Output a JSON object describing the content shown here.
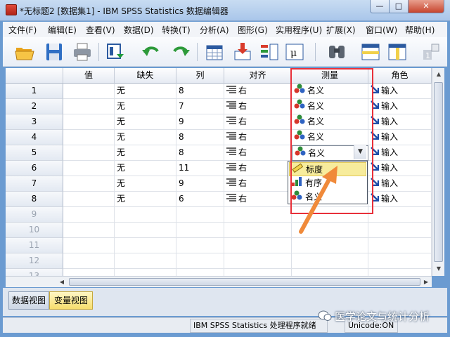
{
  "window": {
    "title": "*无标题2 [数据集1] - IBM SPSS Statistics 数据编辑器",
    "controls": {
      "minimize": "—",
      "maximize": "□",
      "close": "✕"
    }
  },
  "menu": [
    "文件(F)",
    "编辑(E)",
    "查看(V)",
    "数据(D)",
    "转换(T)",
    "分析(A)",
    "图形(G)",
    "实用程序(U)",
    "扩展(X)",
    "窗口(W)",
    "帮助(H)"
  ],
  "toolbar_icons": [
    "open-icon",
    "save-icon",
    "print-icon",
    "dialog-recall-icon",
    "undo-icon",
    "redo-icon",
    "goto-case-icon",
    "goto-variable-icon",
    "variables-icon",
    "run-descriptives-icon",
    "find-icon",
    "insert-cases-icon",
    "insert-variable-icon",
    "split-file-icon"
  ],
  "grid": {
    "columns": [
      "值",
      "缺失",
      "列",
      "对齐",
      "测量",
      "角色"
    ],
    "row_numbers": [
      "1",
      "2",
      "3",
      "4",
      "5",
      "6",
      "7",
      "8",
      "9",
      "10",
      "11",
      "12",
      "13"
    ],
    "rows": [
      {
        "value": "",
        "missing": "无",
        "columns": "8",
        "align": "右",
        "measure": "名义",
        "role": "输入"
      },
      {
        "value": "",
        "missing": "无",
        "columns": "7",
        "align": "右",
        "measure": "名义",
        "role": "输入"
      },
      {
        "value": "",
        "missing": "无",
        "columns": "9",
        "align": "右",
        "measure": "名义",
        "role": "输入"
      },
      {
        "value": "",
        "missing": "无",
        "columns": "8",
        "align": "右",
        "measure": "名义",
        "role": "输入"
      },
      {
        "value": "",
        "missing": "无",
        "columns": "8",
        "align": "右",
        "measure": "名义",
        "role": "输入"
      },
      {
        "value": "",
        "missing": "无",
        "columns": "11",
        "align": "右",
        "measure": "",
        "role": "输入"
      },
      {
        "value": "",
        "missing": "无",
        "columns": "9",
        "align": "右",
        "measure": "",
        "role": "输入"
      },
      {
        "value": "",
        "missing": "无",
        "columns": "6",
        "align": "右",
        "measure": "",
        "role": "输入"
      }
    ]
  },
  "measure_dropdown": {
    "current": "名义",
    "options": [
      "标度",
      "有序",
      "名义"
    ],
    "highlighted": "标度"
  },
  "tabs": {
    "data_view": "数据视图",
    "variable_view": "变量视图",
    "active": "变量视图"
  },
  "status": {
    "processor": "IBM SPSS Statistics 处理程序就绪",
    "unicode": "Unicode:ON"
  },
  "watermark": "医学论文与统计分析",
  "colors": {
    "highlight_box": "#e8303a",
    "arrow": "#f08a3a",
    "selected_option": "#f7ec9c",
    "active_tab": "#f6dd6d"
  }
}
